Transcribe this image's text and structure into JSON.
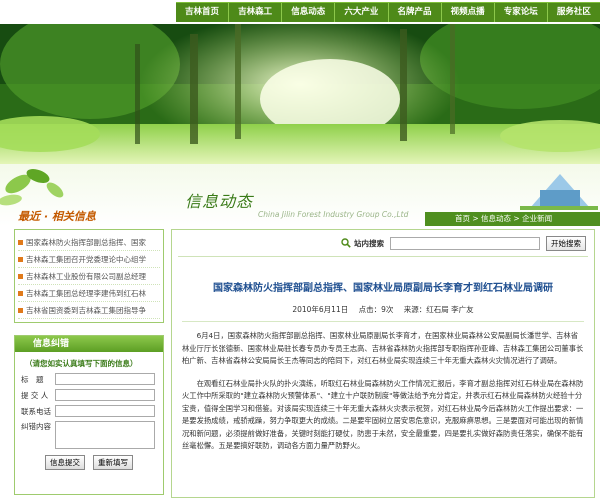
{
  "nav": {
    "items": [
      "吉林首页",
      "吉林森工",
      "信息动态",
      "六大产业",
      "名牌产品",
      "视频点播",
      "专家论坛",
      "服务社区"
    ]
  },
  "header": {
    "related_title": "最近 · 相关信息",
    "section_title": "信息动态",
    "section_subtitle": "China Jilin Forest Industry Group Co.,Ltd",
    "breadcrumb": "首页 > 信息动态 > 企业新闻"
  },
  "sidebar": {
    "news": [
      "国家森林防火指挥部副总指挥、国家",
      "吉林森工集团召开党委理论中心组学",
      "吉林森林工业股份有限公司副总经理",
      "吉林森工集团总经理李建伟到红石林",
      "吉林省国资委到吉林森工集团指导争"
    ],
    "feedback": {
      "title": "信息纠错",
      "note": "（请您如实认真填写下面的信息）",
      "fields": [
        {
          "label": "标　题",
          "value": ""
        },
        {
          "label": "提 交 人",
          "value": ""
        },
        {
          "label": "联系电话",
          "value": ""
        }
      ],
      "content_label": "纠错内容",
      "submit": "信息提交",
      "reset": "重新填写"
    }
  },
  "search": {
    "label": "站内搜索",
    "button": "开始搜索",
    "value": ""
  },
  "article": {
    "title": "国家森林防火指挥部副总指挥、国家林业局原副局长李育才到红石林业局调研",
    "date": "2010年6月11日",
    "hits": "点击：9次",
    "source": "来源：红石局 李广友",
    "paragraphs": [
      "6月4日，国家森林防火指挥部副总指挥、国家林业局原副局长李育才，在国家林业局森林公安局副局长潘世学、吉林省林业厅厅长张德新、国家林业局驻长春专员办专员王志高、吉林省森林防火指挥部专职指挥孙亚峰、吉林森工集团公司董事长柏广新、吉林省森林公安局局长王杰等同志的陪同下，对红石林业局实现连续三十年无重大森林火灾情况进行了调研。",
      "在观看红石林业局扑火队的扑火演练，听取红石林业局森林防火工作情况汇报后，李育才副总指挥对红石林业局在森林防火工作中所采取的\"建立森林防火预警体系\"、\"建立十户联防制度\"等做法给予充分肯定，并表示红石林业局森林防火经验十分宝贵，值得全国学习和借鉴。对该局实现连续三十年无重大森林火灾表示祝贺，对红石林业局今后森林防火工作提出要求：一是要发扬成绩，戒骄戒躁，努力争取更大的成绩。二是要牢固树立居安思危意识，克服麻痹思想。三是要面对可能出现的新情况和新问题，必须提前做好准备，关键时刻能打硬仗，防患于未然，安全最重要，四是要扎实做好森防责任落实，确保不能有丝毫松懈。五是要搞好联防，调动各方面力量严防野火。"
    ]
  }
}
